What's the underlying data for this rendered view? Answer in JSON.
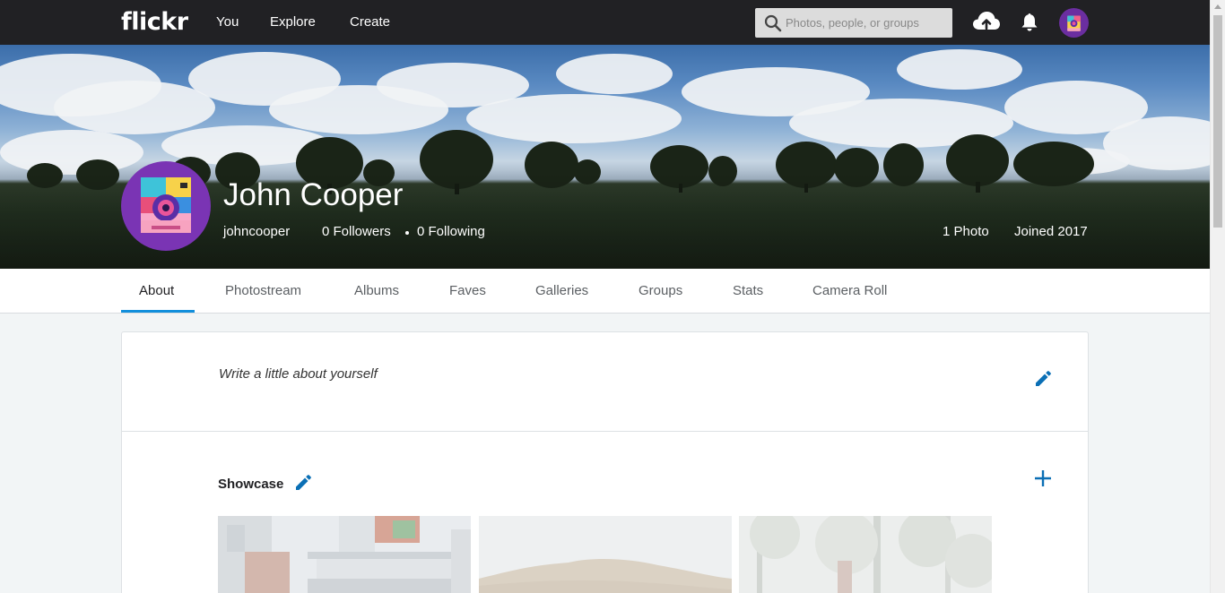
{
  "nav": {
    "logo": "flickr",
    "links": [
      "You",
      "Explore",
      "Create"
    ],
    "search_placeholder": "Photos, people, or groups",
    "icons": [
      "upload-cloud-icon",
      "notification-bell-icon",
      "user-avatar-icon"
    ]
  },
  "profile": {
    "name": "John Cooper",
    "username": "johncooper",
    "followers": "0 Followers",
    "following": "0 Following",
    "photos": "1 Photo",
    "joined": "Joined 2017"
  },
  "tabs": [
    "About",
    "Photostream",
    "Albums",
    "Faves",
    "Galleries",
    "Groups",
    "Stats",
    "Camera Roll"
  ],
  "active_tab": "About",
  "about": {
    "placeholder_text": "Write a little about yourself"
  },
  "showcase": {
    "title": "Showcase"
  },
  "colors": {
    "nav_bg": "#212124",
    "accent": "#128fdc",
    "edit_icon": "#0a6fb5"
  }
}
